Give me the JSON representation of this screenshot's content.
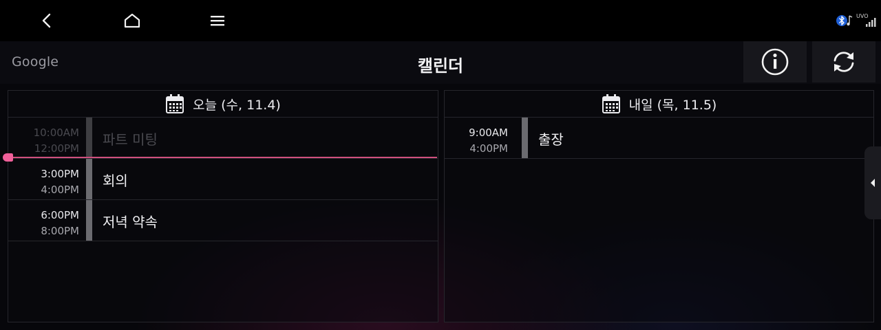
{
  "statusbar": {
    "back_icon": "chevron-left-icon",
    "home_icon": "home-icon",
    "menu_icon": "hamburger-menu-icon",
    "bluetooth_icon": "bluetooth-audio-icon",
    "signal_icon": "uvo-signal-icon",
    "signal_label": "UVO"
  },
  "header": {
    "provider": "Google",
    "title": "캘린더",
    "info_icon": "info-icon",
    "refresh_icon": "refresh-icon"
  },
  "columns": [
    {
      "heading": "오늘 (수, 11.4)",
      "events": [
        {
          "start": "10:00AM",
          "end": "12:00PM",
          "title": "파트 미팅",
          "past": true
        },
        {
          "start": "3:00PM",
          "end": "4:00PM",
          "title": "회의",
          "past": false
        },
        {
          "start": "6:00PM",
          "end": "8:00PM",
          "title": "저녁 약속",
          "past": false
        }
      ]
    },
    {
      "heading": "내일 (목, 11.5)",
      "events": [
        {
          "start": "9:00AM",
          "end": "4:00PM",
          "title": "출장",
          "past": false
        }
      ]
    }
  ],
  "colors": {
    "now_indicator": "#f0609a",
    "event_bar": "#6b6b70"
  }
}
